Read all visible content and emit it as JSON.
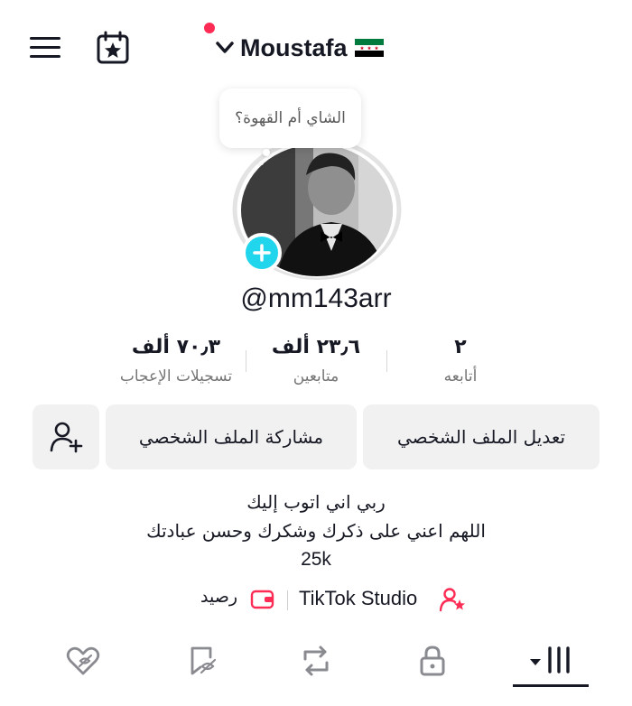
{
  "header": {
    "username": "Moustafa",
    "flag": "syria-revolution-flag-icon",
    "notification_dot_color": "#fe2c55"
  },
  "avatar": {
    "note_bubble": "الشاي أم القهوة؟",
    "add_badge_color": "#20d5ec"
  },
  "profile": {
    "handle": "@mm143arr"
  },
  "stats": [
    {
      "value": "٢",
      "label": "أتابعه"
    },
    {
      "value": "٢٣٫٦ ألف",
      "label": "متابعين"
    },
    {
      "value": "٧٠٫٣ ألف",
      "label": "تسجيلات الإعجاب"
    }
  ],
  "actions": {
    "edit_profile": "تعديل الملف الشخصي",
    "share_profile": "مشاركة الملف الشخصي",
    "add_friend_icon": "add-user-icon"
  },
  "bio": {
    "line1": "ربي اني اتوب إليك",
    "line2": "اللهم اعني على ذكرك وشكرك وحسن عبادتك",
    "line3": "25k"
  },
  "links": {
    "studio": "TikTok Studio",
    "balance": "رصيد"
  },
  "tabs": [
    {
      "icon": "videos-grid-icon",
      "active": true
    },
    {
      "icon": "lock-icon",
      "active": false
    },
    {
      "icon": "repost-icon",
      "active": false
    },
    {
      "icon": "favorites-icon",
      "active": false
    },
    {
      "icon": "liked-icon",
      "active": false
    }
  ],
  "colors": {
    "text": "#161823",
    "secondary_text": "#757575",
    "button_bg": "#f1f1f2",
    "accent_pink": "#fe2c55"
  }
}
